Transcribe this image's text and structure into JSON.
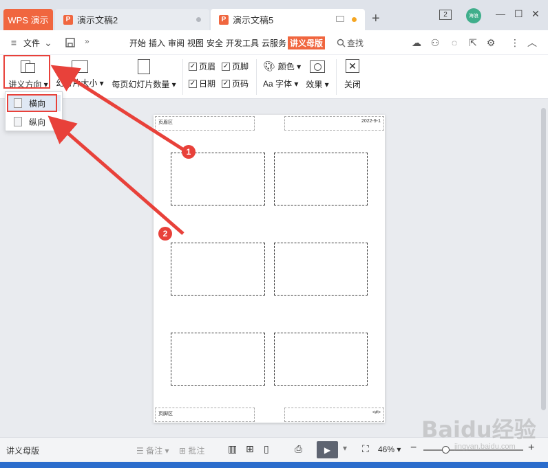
{
  "titlebar": {
    "app_tab": "WPS 演示",
    "tabs": [
      {
        "label": "演示文稿2",
        "icon": "P"
      },
      {
        "label": "演示文稿5",
        "icon": "P"
      }
    ],
    "new_tab": "+",
    "tab_count": "2",
    "avatar_text": "海浪",
    "minimize": "—",
    "maximize": "☐",
    "close": "✕"
  },
  "menubar": {
    "file": "文件",
    "expand": "»",
    "items": [
      "开始",
      "插入",
      "审阅",
      "视图",
      "安全",
      "开发工具",
      "云服务"
    ],
    "active": "讲义母版",
    "search": "查找"
  },
  "ribbon": {
    "orientation": "讲义方向",
    "slide_size": "幻灯片大小",
    "per_page": "每页幻灯片数量",
    "header": "页眉",
    "footer": "页脚",
    "date": "日期",
    "page_number": "页码",
    "color": "颜色",
    "font": "Aa 字体",
    "effect": "效果",
    "close": "关闭"
  },
  "dropdown": {
    "landscape": "横向",
    "portrait": "纵向"
  },
  "page": {
    "header_zone": "页眉区",
    "date": "2022-9-1",
    "footer_zone": "页脚区",
    "page_number": "<#>"
  },
  "annotations": {
    "badge1": "1",
    "badge2": "2",
    "red_color": "#e8413a"
  },
  "statusbar": {
    "mode": "讲义母版",
    "notes": "备注",
    "comments": "批注",
    "zoom": "46%"
  },
  "watermark": {
    "brand": "Baidu经验",
    "url": "jingyan.baidu.com"
  },
  "colors": {
    "accent": "#f0663f",
    "titlebar": "#dfe3ea"
  }
}
